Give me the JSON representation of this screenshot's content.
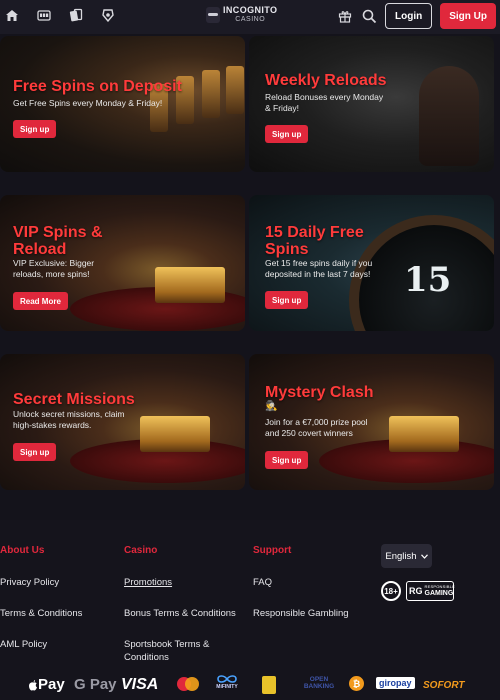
{
  "header": {
    "logo_line1": "INCOGNITO",
    "logo_line2": "CASINO",
    "login_label": "Login",
    "signup_label": "Sign Up",
    "icons": [
      "home-icon",
      "slot-machine-icon",
      "cards-icon",
      "sports-icon",
      "gift-icon",
      "search-icon"
    ]
  },
  "promos": [
    {
      "title": "Free Spins on Deposit",
      "desc": "Get Free Spins every Monday & Friday!",
      "cta": "Sign up"
    },
    {
      "title": "Weekly Reloads",
      "desc": "Reload Bonuses every Monday & Friday!",
      "cta": "Sign up"
    },
    {
      "title": "VIP Spins & Reload",
      "desc": "VIP Exclusive: Bigger reloads, more spins!",
      "cta": "Read More"
    },
    {
      "title": "15 Daily Free Spins",
      "desc": "Get 15 free spins daily if you deposited in the last 7 days!",
      "cta": "Sign up"
    },
    {
      "title": "Secret Missions",
      "desc": "Unlock secret missions, claim high-stakes rewards.",
      "cta": "Sign up"
    },
    {
      "title": "Mystery Clash",
      "desc": "Join for a €7,000 prize pool and 250 covert winners",
      "cta": "Sign up"
    }
  ],
  "wheel_number": "15",
  "footer": {
    "about": {
      "heading": "About Us",
      "links": [
        "Privacy Policy",
        "Terms & Conditions",
        "AML Policy"
      ]
    },
    "casino": {
      "heading": "Casino",
      "links": [
        "Promotions",
        "Bonus Terms & Conditions",
        "Sportsbook Terms & Conditions"
      ]
    },
    "support": {
      "heading": "Support",
      "links": [
        "FAQ",
        "Responsible Gambling"
      ]
    },
    "language": "English",
    "age_badge": "18+",
    "rg_mark": "RG",
    "rg_small": "RESPONSIBLE",
    "rg_big": "GAMING"
  },
  "payments": [
    "Pay",
    "G Pay",
    "VISA",
    "MiFINITY",
    "OPEN BANKING",
    "giropay",
    "SOFORT"
  ],
  "colors": {
    "accent": "#e0283c",
    "background": "#14131b",
    "header": "#1b1a24"
  }
}
